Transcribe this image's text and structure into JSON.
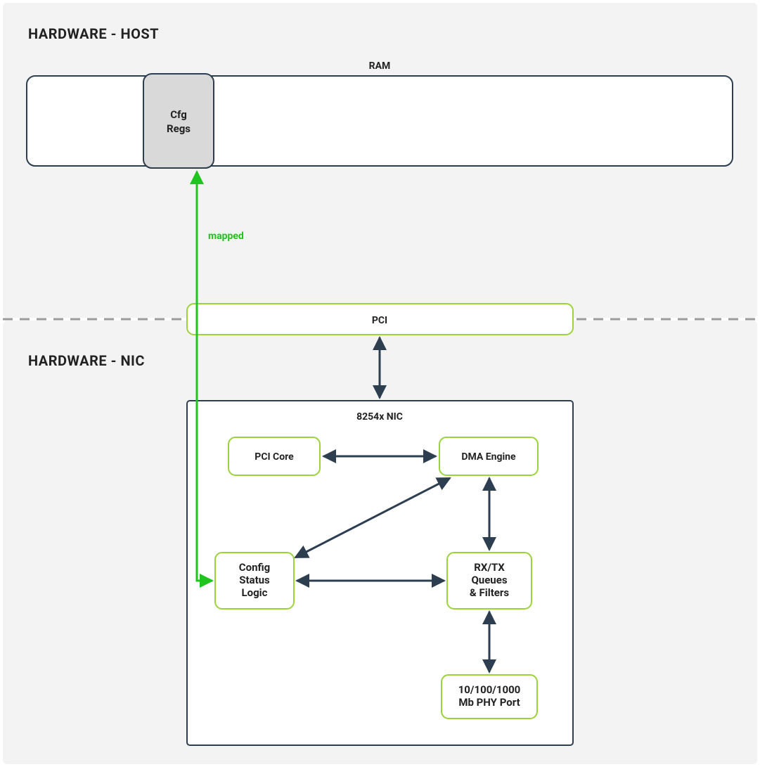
{
  "sections": {
    "host": "HARDWARE - HOST",
    "nic": "HARDWARE - NIC"
  },
  "labels": {
    "ram": "RAM",
    "cfgregs1": "Cfg",
    "cfgregs2": "Regs",
    "pci": "PCI",
    "nictitle": "8254x NIC",
    "pcicore": "PCI Core",
    "dma": "DMA Engine",
    "csl1": "Config",
    "csl2": "Status",
    "csl3": "Logic",
    "rx1": "RX/TX",
    "rx2": "Queues",
    "rx3": "& Filters",
    "phy1": "10/100/1000",
    "phy2": "Mb PHY Port",
    "mapped": "mapped"
  },
  "colors": {
    "bg": "#f3f3f3",
    "rimDark": "#2d3e50",
    "rimLime": "#9cd33a",
    "mapped": "#1fc41f",
    "greyFill": "#d9d9d9"
  }
}
